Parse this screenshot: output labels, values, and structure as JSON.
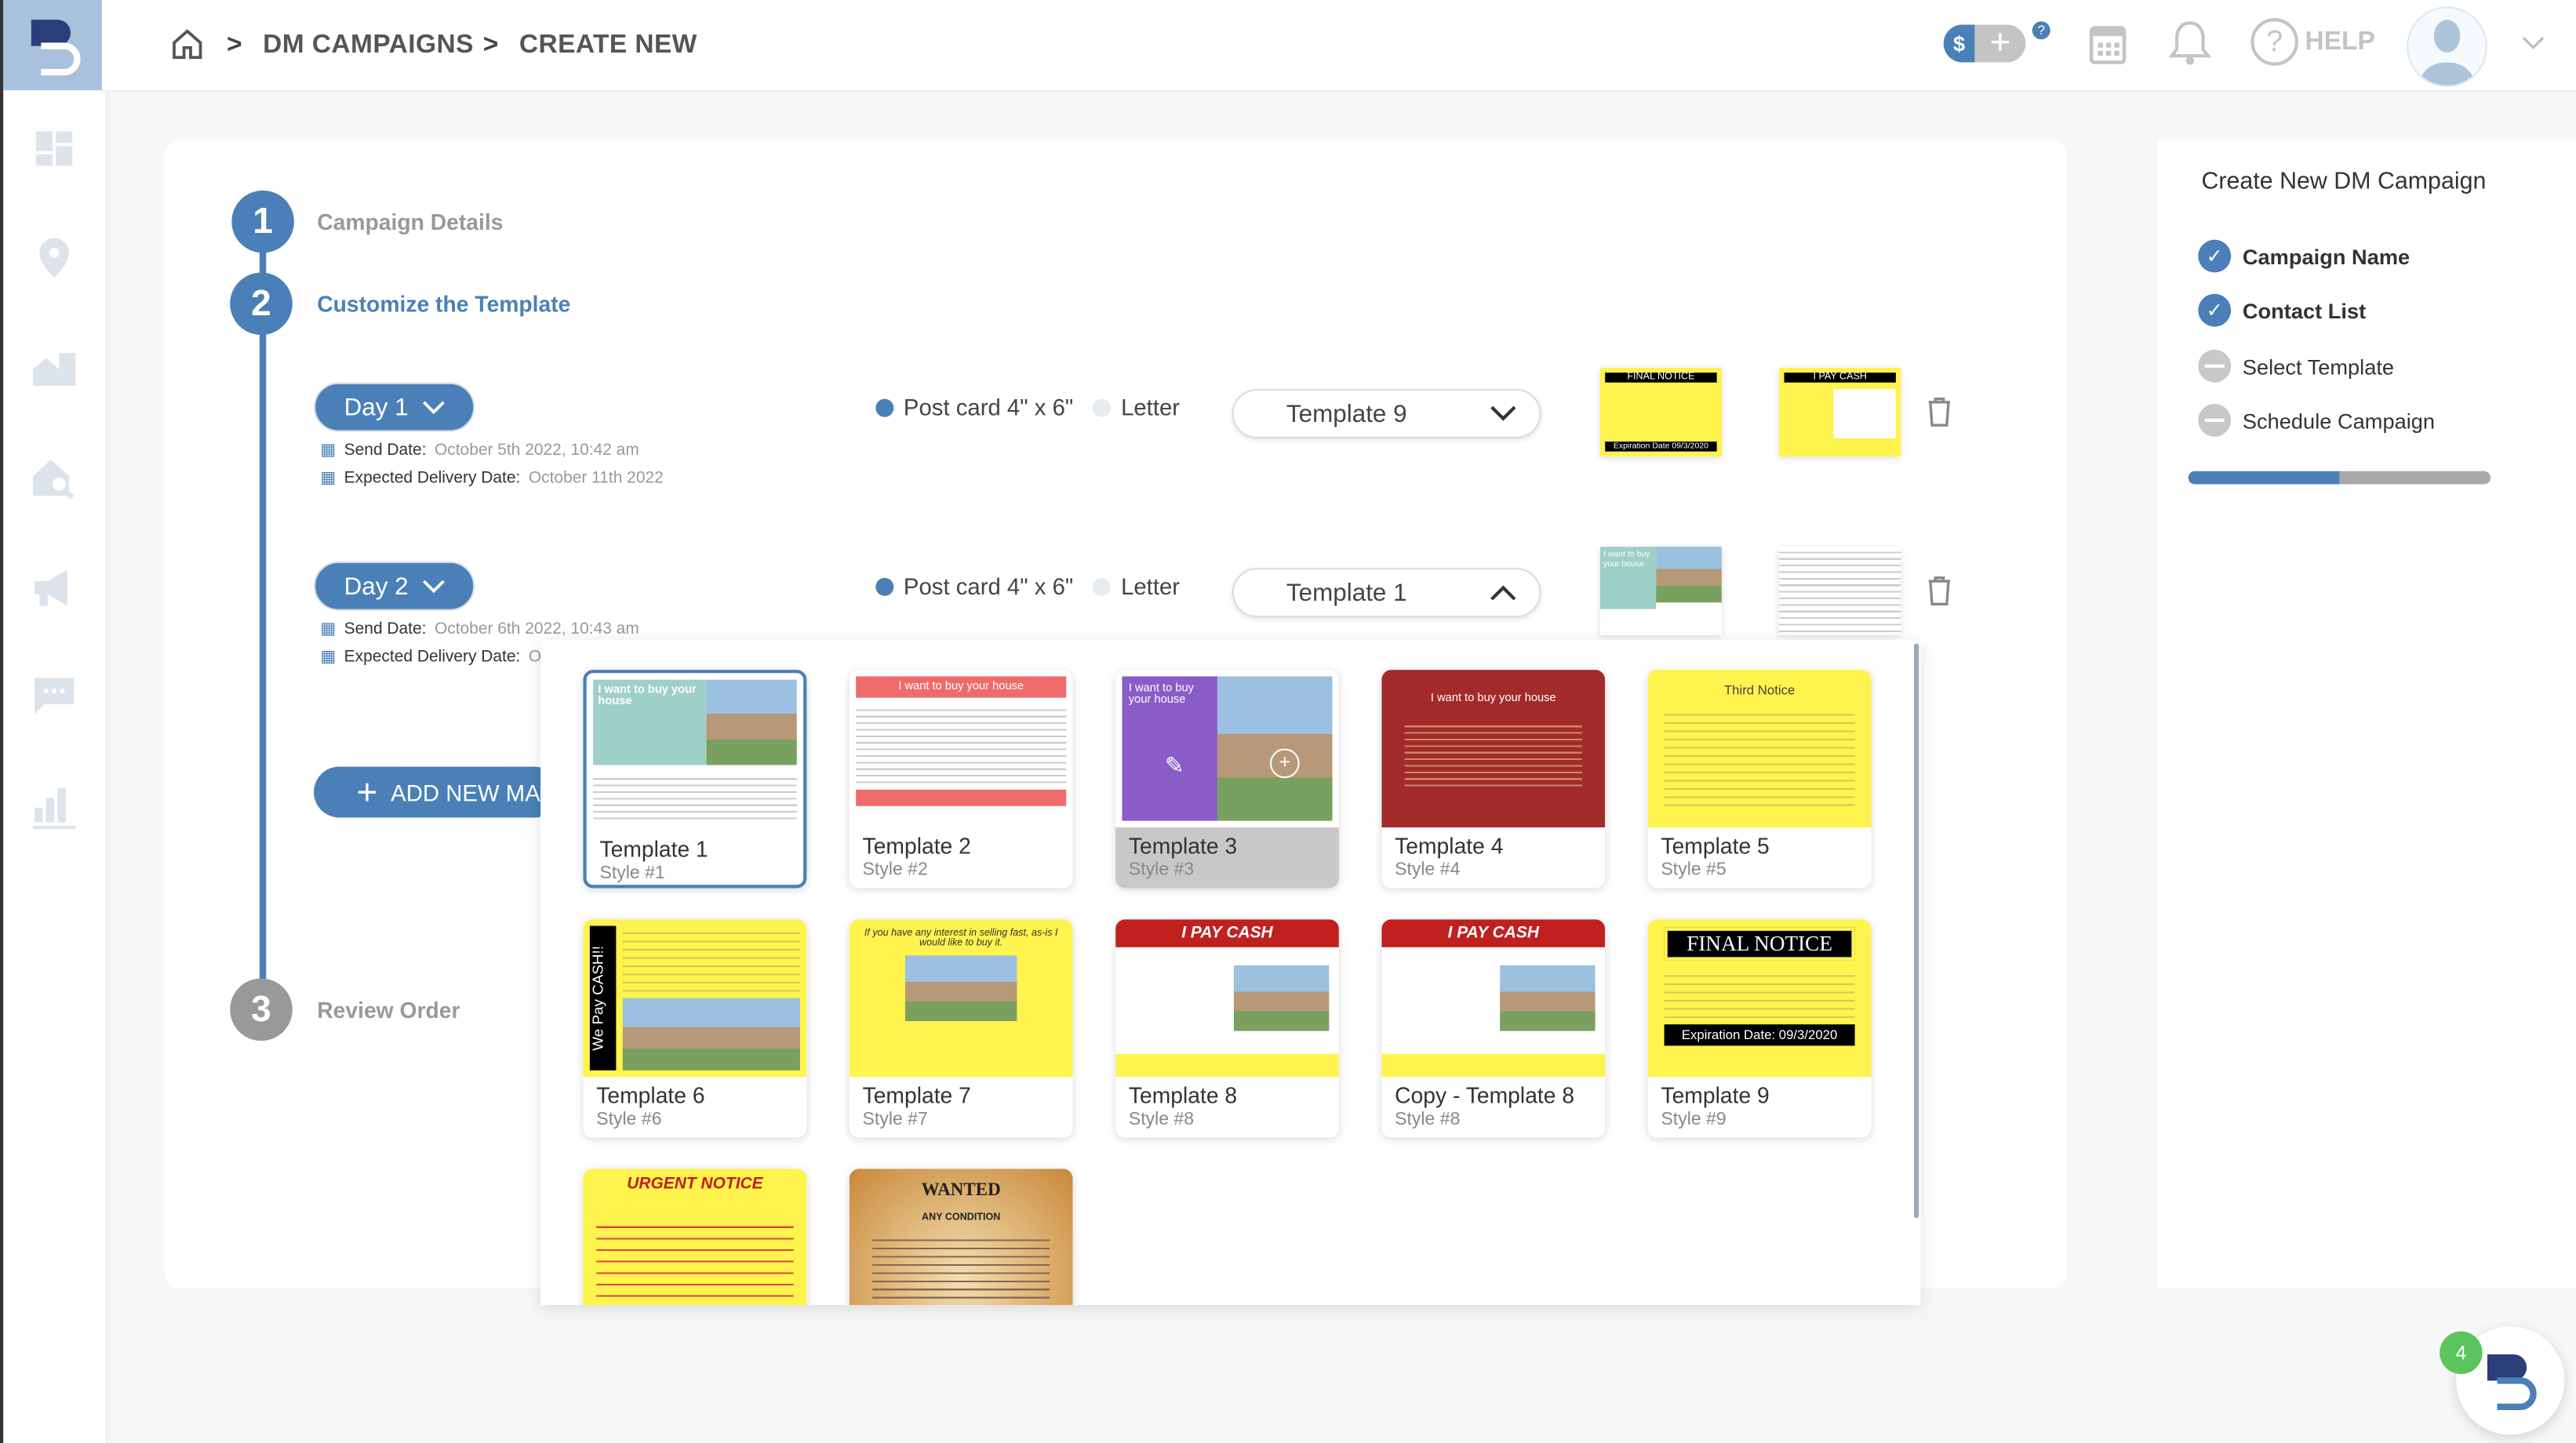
{
  "breadcrumb": [
    "DM CAMPAIGNS",
    "CREATE NEW"
  ],
  "header": {
    "help_label": "HELP",
    "credits_badge": "?"
  },
  "colors": {
    "accent": "#4a80b7",
    "sidebar_logo_bg": "#a9c1dc",
    "postcard_yellow": "#fff34d",
    "progress_rest": "#a8a8a8"
  },
  "steps": [
    {
      "num": "1",
      "label": "Campaign Details"
    },
    {
      "num": "2",
      "label": "Customize the Template"
    },
    {
      "num": "3",
      "label": "Review Order"
    }
  ],
  "days": [
    {
      "label": "Day 1",
      "send_label": "Send Date:",
      "send_value": "October 5th 2022, 10:42 am",
      "delivery_label": "Expected Delivery Date:",
      "delivery_value": "October 11th 2022",
      "format_postcard": "Post card 4\" x 6\"",
      "format_letter": "Letter",
      "template": "Template 9",
      "mini1": "FINAL NOTICE",
      "mini1b": "Expiration Date 09/3/2020",
      "mini2": "I PAY CASH"
    },
    {
      "label": "Day 2",
      "send_label": "Send Date:",
      "send_value": "October 6th 2022, 10:43 am",
      "delivery_label": "Expected Delivery Date:",
      "delivery_value": "O",
      "format_postcard": "Post card 4\" x 6\"",
      "format_letter": "Letter",
      "template": "Template 1",
      "mini1": "I want to buy your house"
    }
  ],
  "add_button": "ADD NEW MAI",
  "templates": [
    {
      "name": "Template 1",
      "style": "Style #1",
      "headline": "I want to buy your house"
    },
    {
      "name": "Template 2",
      "style": "Style #2",
      "headline": "I want to buy your house"
    },
    {
      "name": "Template 3",
      "style": "Style #3",
      "headline": "I want to buy your house"
    },
    {
      "name": "Template 4",
      "style": "Style #4",
      "headline": "I want to buy your house"
    },
    {
      "name": "Template 5",
      "style": "Style #5",
      "headline": "Third Notice"
    },
    {
      "name": "Template 6",
      "style": "Style #6",
      "headline": "We Pay CASH!!"
    },
    {
      "name": "Template 7",
      "style": "Style #7",
      "headline": "If you have any interest in selling fast, as-is I would like to buy it."
    },
    {
      "name": "Template 8",
      "style": "Style #8",
      "headline": "I PAY CASH"
    },
    {
      "name": "Copy - Template 8",
      "style": "Style #8",
      "headline": "I PAY CASH"
    },
    {
      "name": "Template 9",
      "style": "Style #9",
      "headline": "FINAL NOTICE",
      "footer": "Expiration Date: 09/3/2020"
    },
    {
      "name": "",
      "style": "",
      "headline": "URGENT NOTICE"
    },
    {
      "name": "",
      "style": "",
      "headline": "WANTED",
      "sub": "ANY CONDITION"
    }
  ],
  "right_panel": {
    "title": "Create New DM Campaign",
    "items": [
      {
        "label": "Campaign Name",
        "done": true
      },
      {
        "label": "Contact List",
        "done": true
      },
      {
        "label": "Select Template",
        "done": false
      },
      {
        "label": "Schedule Campaign",
        "done": false
      }
    ],
    "progress": 0.5
  },
  "chat_badge": "4"
}
